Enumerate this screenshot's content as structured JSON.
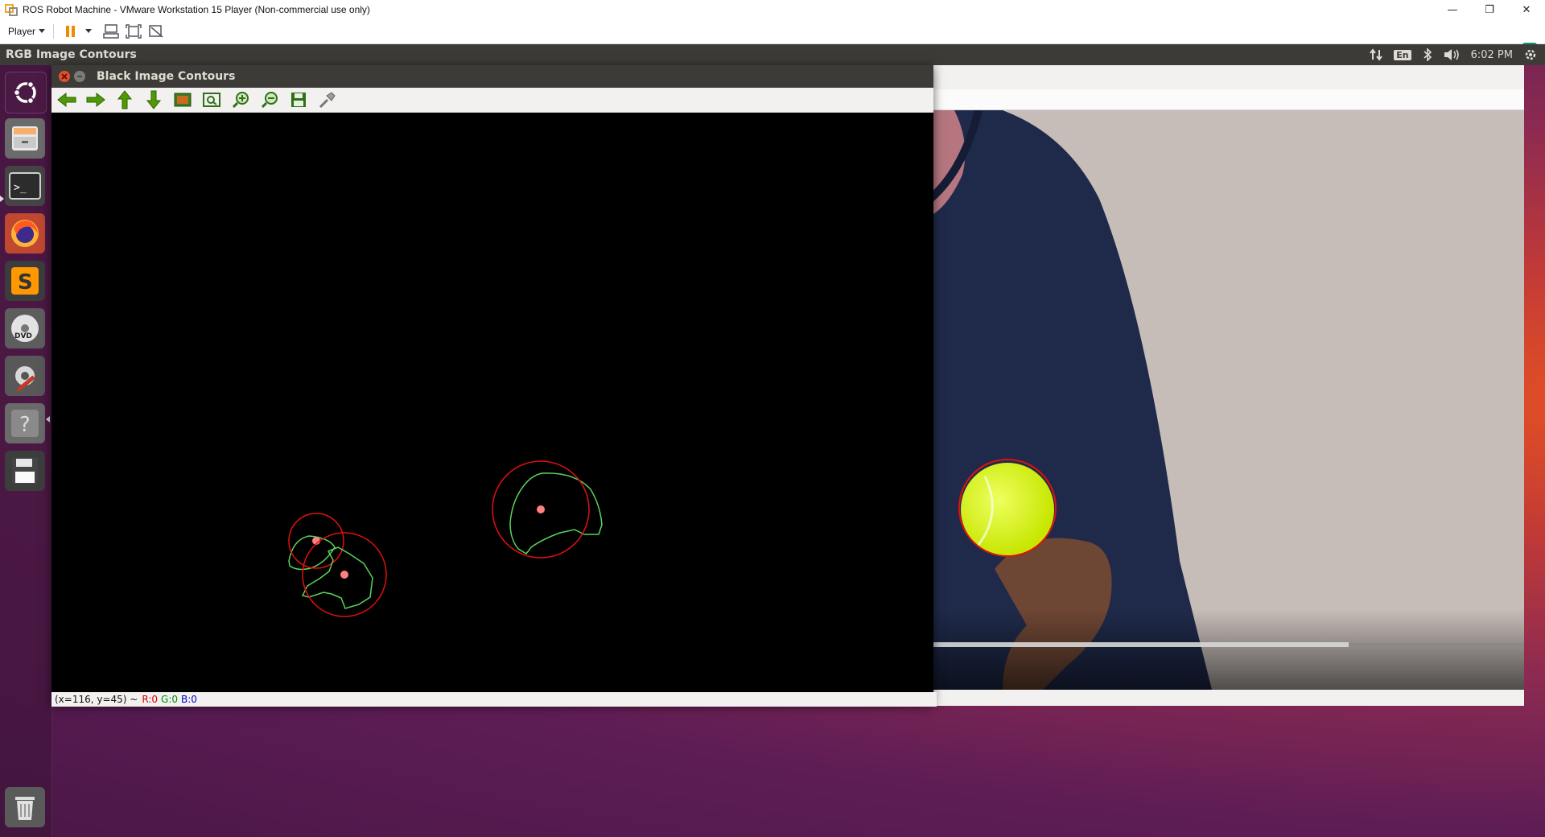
{
  "host": {
    "window_title": "ROS Robot Machine - VMware Workstation 15 Player (Non-commercial use only)",
    "player_menu": "Player",
    "controls": {
      "minimize": "—",
      "restore": "❐",
      "close": "✕"
    }
  },
  "guest": {
    "top_panel": {
      "active_app": "RGB Image Contours",
      "keyboard_layout": "En",
      "clock": "6:02 PM"
    },
    "launcher": {
      "items": [
        {
          "name": "ubuntu-dash",
          "icon": "ubuntu-logo-icon"
        },
        {
          "name": "files",
          "icon": "file-cabinet-icon"
        },
        {
          "name": "terminal",
          "icon": "terminal-icon",
          "label": ">_"
        },
        {
          "name": "firefox",
          "icon": "firefox-icon"
        },
        {
          "name": "sublime-text",
          "icon": "sublime-icon",
          "label": "S"
        },
        {
          "name": "dvd",
          "icon": "dvd-icon",
          "label": "DVD"
        },
        {
          "name": "system-settings",
          "icon": "settings-wrench-icon"
        },
        {
          "name": "help",
          "icon": "help-icon",
          "label": "?"
        },
        {
          "name": "save",
          "icon": "floppy-icon"
        },
        {
          "name": "trash",
          "icon": "trash-icon"
        }
      ]
    },
    "black_window": {
      "title": "Black Image Contours",
      "toolbar": [
        "pan-left-icon",
        "pan-right-icon",
        "pan-up-icon",
        "pan-down-icon",
        "zoom-original-icon",
        "zoom-fit-icon",
        "zoom-in-icon",
        "zoom-out-icon",
        "save-icon",
        "properties-icon"
      ],
      "status": {
        "coords": "(x=116, y=45) ~",
        "r": "R:0",
        "g": "G:0",
        "b": "B:0"
      }
    },
    "rgb_window": {
      "title": "RGB Image Contours"
    }
  },
  "colors": {
    "contour_green": "#5bd35b",
    "circle_red": "#e01010",
    "center_pink": "#ff8080",
    "ball": "#d9ff2a"
  }
}
